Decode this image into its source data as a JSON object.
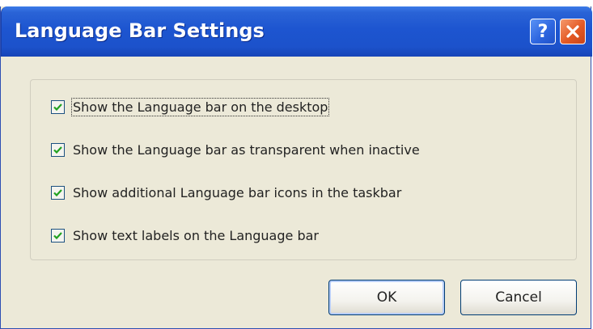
{
  "dialog": {
    "title": "Language Bar Settings",
    "help_glyph": "?",
    "close_icon": "close-icon"
  },
  "options": [
    {
      "label": "Show the Language bar on the desktop",
      "checked": true
    },
    {
      "label": "Show the Language bar as transparent when inactive",
      "checked": true
    },
    {
      "label": "Show additional Language bar icons in the taskbar",
      "checked": true
    },
    {
      "label": "Show text labels on the Language bar",
      "checked": true
    }
  ],
  "buttons": {
    "ok_label": "OK",
    "cancel_label": "Cancel"
  },
  "colors": {
    "titlebar": "#1d55d0",
    "dialog_bg": "#ece9d8",
    "checkmark": "#21a121",
    "close_button": "#e45a25"
  }
}
